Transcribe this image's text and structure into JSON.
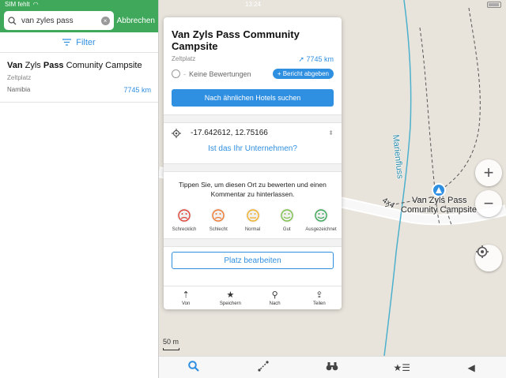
{
  "status_bar": {
    "carrier": "SIM fehlt",
    "time": "13:24"
  },
  "search": {
    "query": "van zyles pass",
    "cancel_label": "Abbrechen",
    "filter_label": "Filter"
  },
  "result": {
    "name_bold_1": "Van",
    "name_mid": " Zyls ",
    "name_bold_2": "Pass",
    "name_rest": " Comunity Campsite",
    "type": "Zeltplatz",
    "country": "Namibia",
    "distance": "7745 km"
  },
  "card": {
    "title": "Van Zyls Pass Community Campsite",
    "type": "Zeltplatz",
    "distance": "7745 km",
    "rating_separator": "-",
    "no_reviews": "Keine Bewertungen",
    "report_button": "+ Bericht abgeben",
    "similar_hotels_button": "Nach ähnlichen Hotels suchen",
    "coordinates": "-17.642612, 12.75166",
    "owner_link": "Ist das Ihr Unternehmen?",
    "rate_prompt": "Tippen Sie, um diesen Ort zu bewerten und einen Kommentar zu hinterlassen.",
    "faces": [
      {
        "label": "Schrecklich",
        "color": "#e0453a",
        "mood": "sad"
      },
      {
        "label": "Schlecht",
        "color": "#ee7a32",
        "mood": "sad"
      },
      {
        "label": "Normal",
        "color": "#f2b026",
        "mood": "neutral"
      },
      {
        "label": "Gut",
        "color": "#7cc14a",
        "mood": "happy"
      },
      {
        "label": "Ausgezeichnet",
        "color": "#3aa858",
        "mood": "happy"
      }
    ],
    "edit_button": "Platz bearbeiten",
    "actions": [
      {
        "label": "Von",
        "icon": "route-from-icon"
      },
      {
        "label": "Speichern",
        "icon": "star-plus-icon"
      },
      {
        "label": "Nach",
        "icon": "route-to-icon"
      },
      {
        "label": "Teilen",
        "icon": "share-icon"
      }
    ]
  },
  "map": {
    "poi_label_1": "Van Zyls Pass",
    "poi_label_2": "Comunity Campsite",
    "river_label": "Marienfluss",
    "road_label": "4x4",
    "scale_label": "50 m"
  },
  "colors": {
    "accent": "#2f8fe0",
    "brand_green": "#3fa85b"
  }
}
